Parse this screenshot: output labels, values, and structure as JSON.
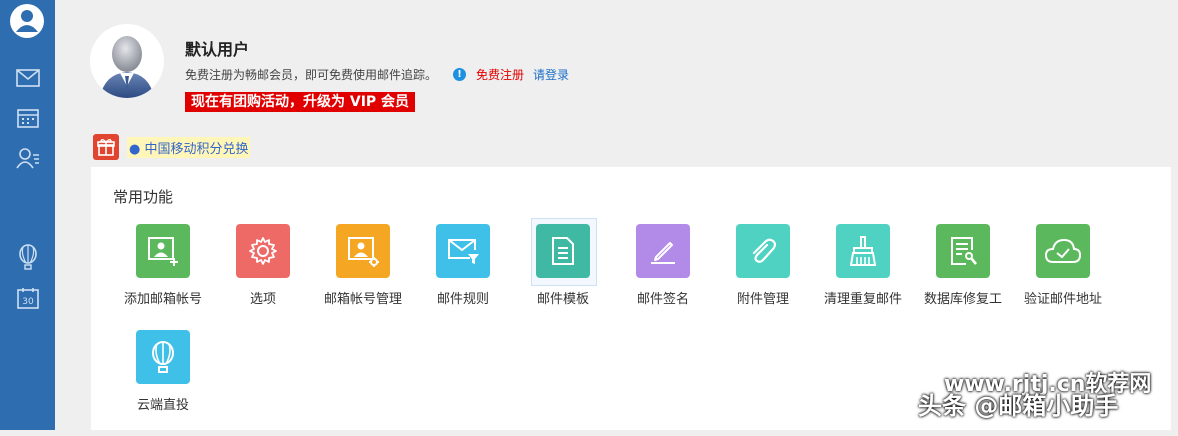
{
  "user": {
    "name": "默认用户",
    "promo_text": "免费注册为畅邮会员，即可免费使用邮件追踪。",
    "register_link": "免费注册",
    "login_link": "请登录",
    "vip_banner": "现在有团购活动，升级为 VIP 会员"
  },
  "cmcc_link": "● 中国移动积分兑换",
  "panel": {
    "title": "常用功能",
    "tiles": [
      {
        "label": "添加邮箱帐号",
        "color": "#5cb85c",
        "icon": "add-account-icon"
      },
      {
        "label": "选项",
        "color": "#ed6a67",
        "icon": "gear-icon"
      },
      {
        "label": "邮箱帐号管理",
        "color": "#f5a623",
        "icon": "account-settings-icon"
      },
      {
        "label": "邮件规则",
        "color": "#3ec0e8",
        "icon": "mail-filter-icon"
      },
      {
        "label": "邮件模板",
        "color": "#3fb9a3",
        "icon": "document-icon"
      },
      {
        "label": "邮件签名",
        "color": "#b28be8",
        "icon": "pen-icon"
      },
      {
        "label": "附件管理",
        "color": "#4fd2c2",
        "icon": "paperclip-icon"
      },
      {
        "label": "清理重复邮件",
        "color": "#4fd2c2",
        "icon": "broom-icon"
      },
      {
        "label": "数据库修复工",
        "color": "#5cb85c",
        "icon": "database-repair-icon"
      },
      {
        "label": "验证邮件地址",
        "color": "#5cb85c",
        "icon": "cloud-check-icon"
      },
      {
        "label": "云端直投",
        "color": "#3ec0e8",
        "icon": "balloon-icon"
      }
    ]
  },
  "watermark": {
    "line1": "www.rjtj.cn软荐网",
    "line2": "头条 @邮箱小助手"
  }
}
